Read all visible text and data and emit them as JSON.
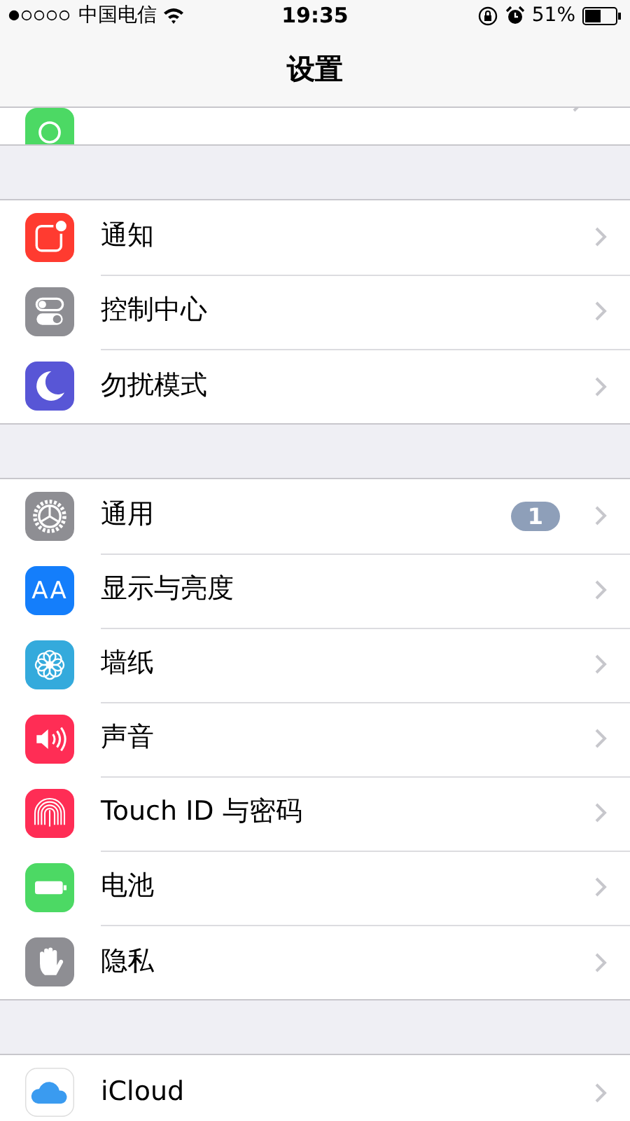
{
  "status_bar": {
    "carrier": "中国电信",
    "time": "19:35",
    "battery": "51%"
  },
  "navigation": {
    "title": "设置"
  },
  "top_row": {
    "kind": "hotspot"
  },
  "groups": [
    {
      "items": [
        {
          "kind": "notifications",
          "label": "通知"
        },
        {
          "kind": "control",
          "label": "控制中心"
        },
        {
          "kind": "moon",
          "label": "勿扰模式"
        }
      ]
    },
    {
      "items": [
        {
          "kind": "gear",
          "label": "通用",
          "badge": "1"
        },
        {
          "kind": "text",
          "icon_text": "AA",
          "label": "显示与亮度"
        },
        {
          "kind": "flower",
          "label": "墙纸"
        },
        {
          "kind": "speaker",
          "label": "声音"
        },
        {
          "kind": "fingerprint",
          "label": "Touch ID 与密码"
        },
        {
          "kind": "battery",
          "label": "电池"
        },
        {
          "kind": "hand",
          "label": "隐私"
        }
      ]
    },
    {
      "items": [
        {
          "kind": "cloud",
          "label": "iCloud"
        }
      ]
    }
  ]
}
